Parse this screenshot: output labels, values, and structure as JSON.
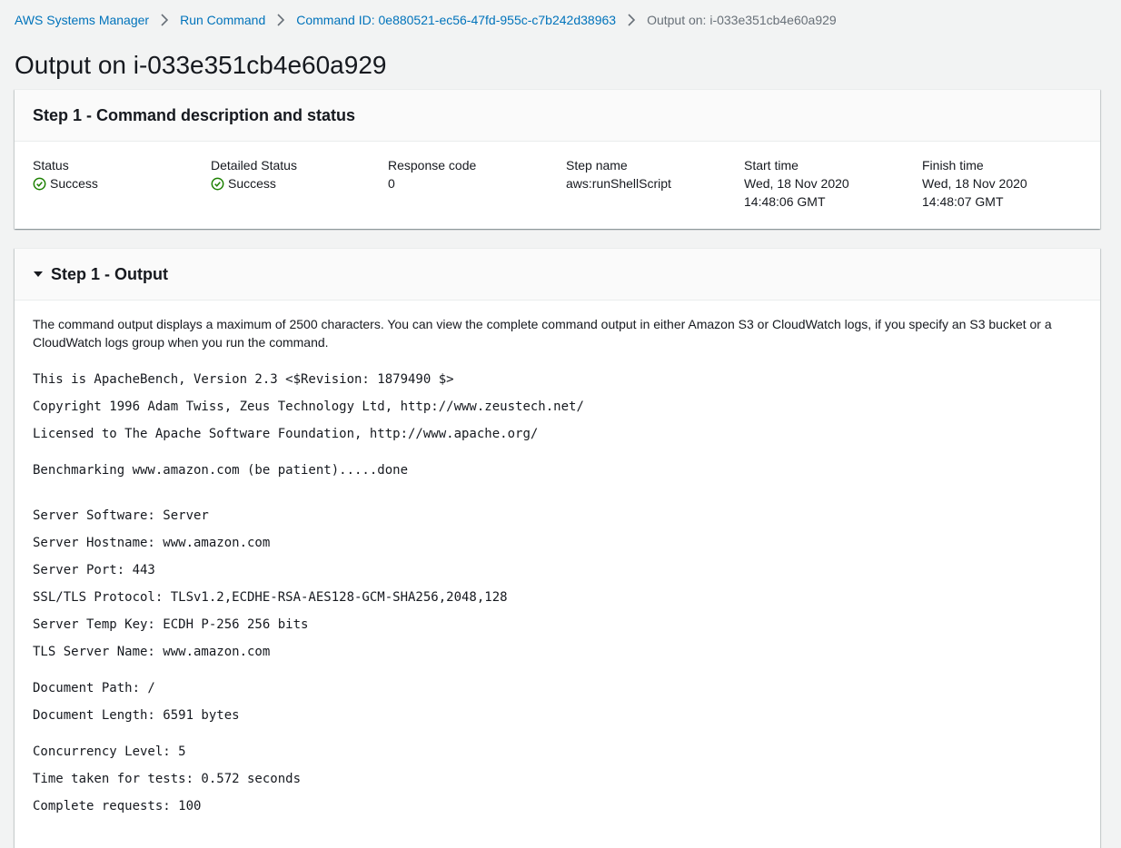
{
  "breadcrumb": {
    "items": [
      "AWS Systems Manager",
      "Run Command",
      "Command ID: 0e880521-ec56-47fd-955c-c7b242d38963"
    ],
    "current": "Output on: i-033e351cb4e60a929"
  },
  "page_title": "Output on i-033e351cb4e60a929",
  "step1_status": {
    "title": "Step 1 - Command description and status",
    "fields": {
      "status": {
        "label": "Status",
        "value": "Success"
      },
      "detailed_status": {
        "label": "Detailed Status",
        "value": "Success"
      },
      "response_code": {
        "label": "Response code",
        "value": "0"
      },
      "step_name": {
        "label": "Step name",
        "value": "aws:runShellScript"
      },
      "start_time": {
        "label": "Start time",
        "line1": "Wed, 18 Nov 2020",
        "line2": "14:48:06 GMT"
      },
      "finish_time": {
        "label": "Finish time",
        "line1": "Wed, 18 Nov 2020",
        "line2": "14:48:07 GMT"
      }
    }
  },
  "step1_output": {
    "title": "Step 1 - Output",
    "note_line1": "The command output displays a maximum of 2500 characters. You can view the complete command output in either Amazon S3 or CloudWatch logs, if you specify an S3 bucket or a",
    "note_line2": "CloudWatch logs group when you run the command.",
    "lines": [
      "This is ApacheBench, Version 2.3 <$Revision: 1879490 $>",
      "Copyright 1996 Adam Twiss, Zeus Technology Ltd, http://www.zeustech.net/",
      "Licensed to The Apache Software Foundation, http://www.apache.org/",
      "Benchmarking www.amazon.com (be patient).....done",
      "Server Software: Server",
      "Server Hostname: www.amazon.com",
      "Server Port: 443",
      "SSL/TLS Protocol: TLSv1.2,ECDHE-RSA-AES128-GCM-SHA256,2048,128",
      "Server Temp Key: ECDH P-256 256 bits",
      "TLS Server Name: www.amazon.com",
      "Document Path: /",
      "Document Length: 6591 bytes",
      "Concurrency Level: 5",
      "Time taken for tests: 0.572 seconds",
      "Complete requests: 100"
    ]
  },
  "colors": {
    "link": "#0073bb",
    "success": "#1d8102",
    "background": "#f2f3f3"
  }
}
